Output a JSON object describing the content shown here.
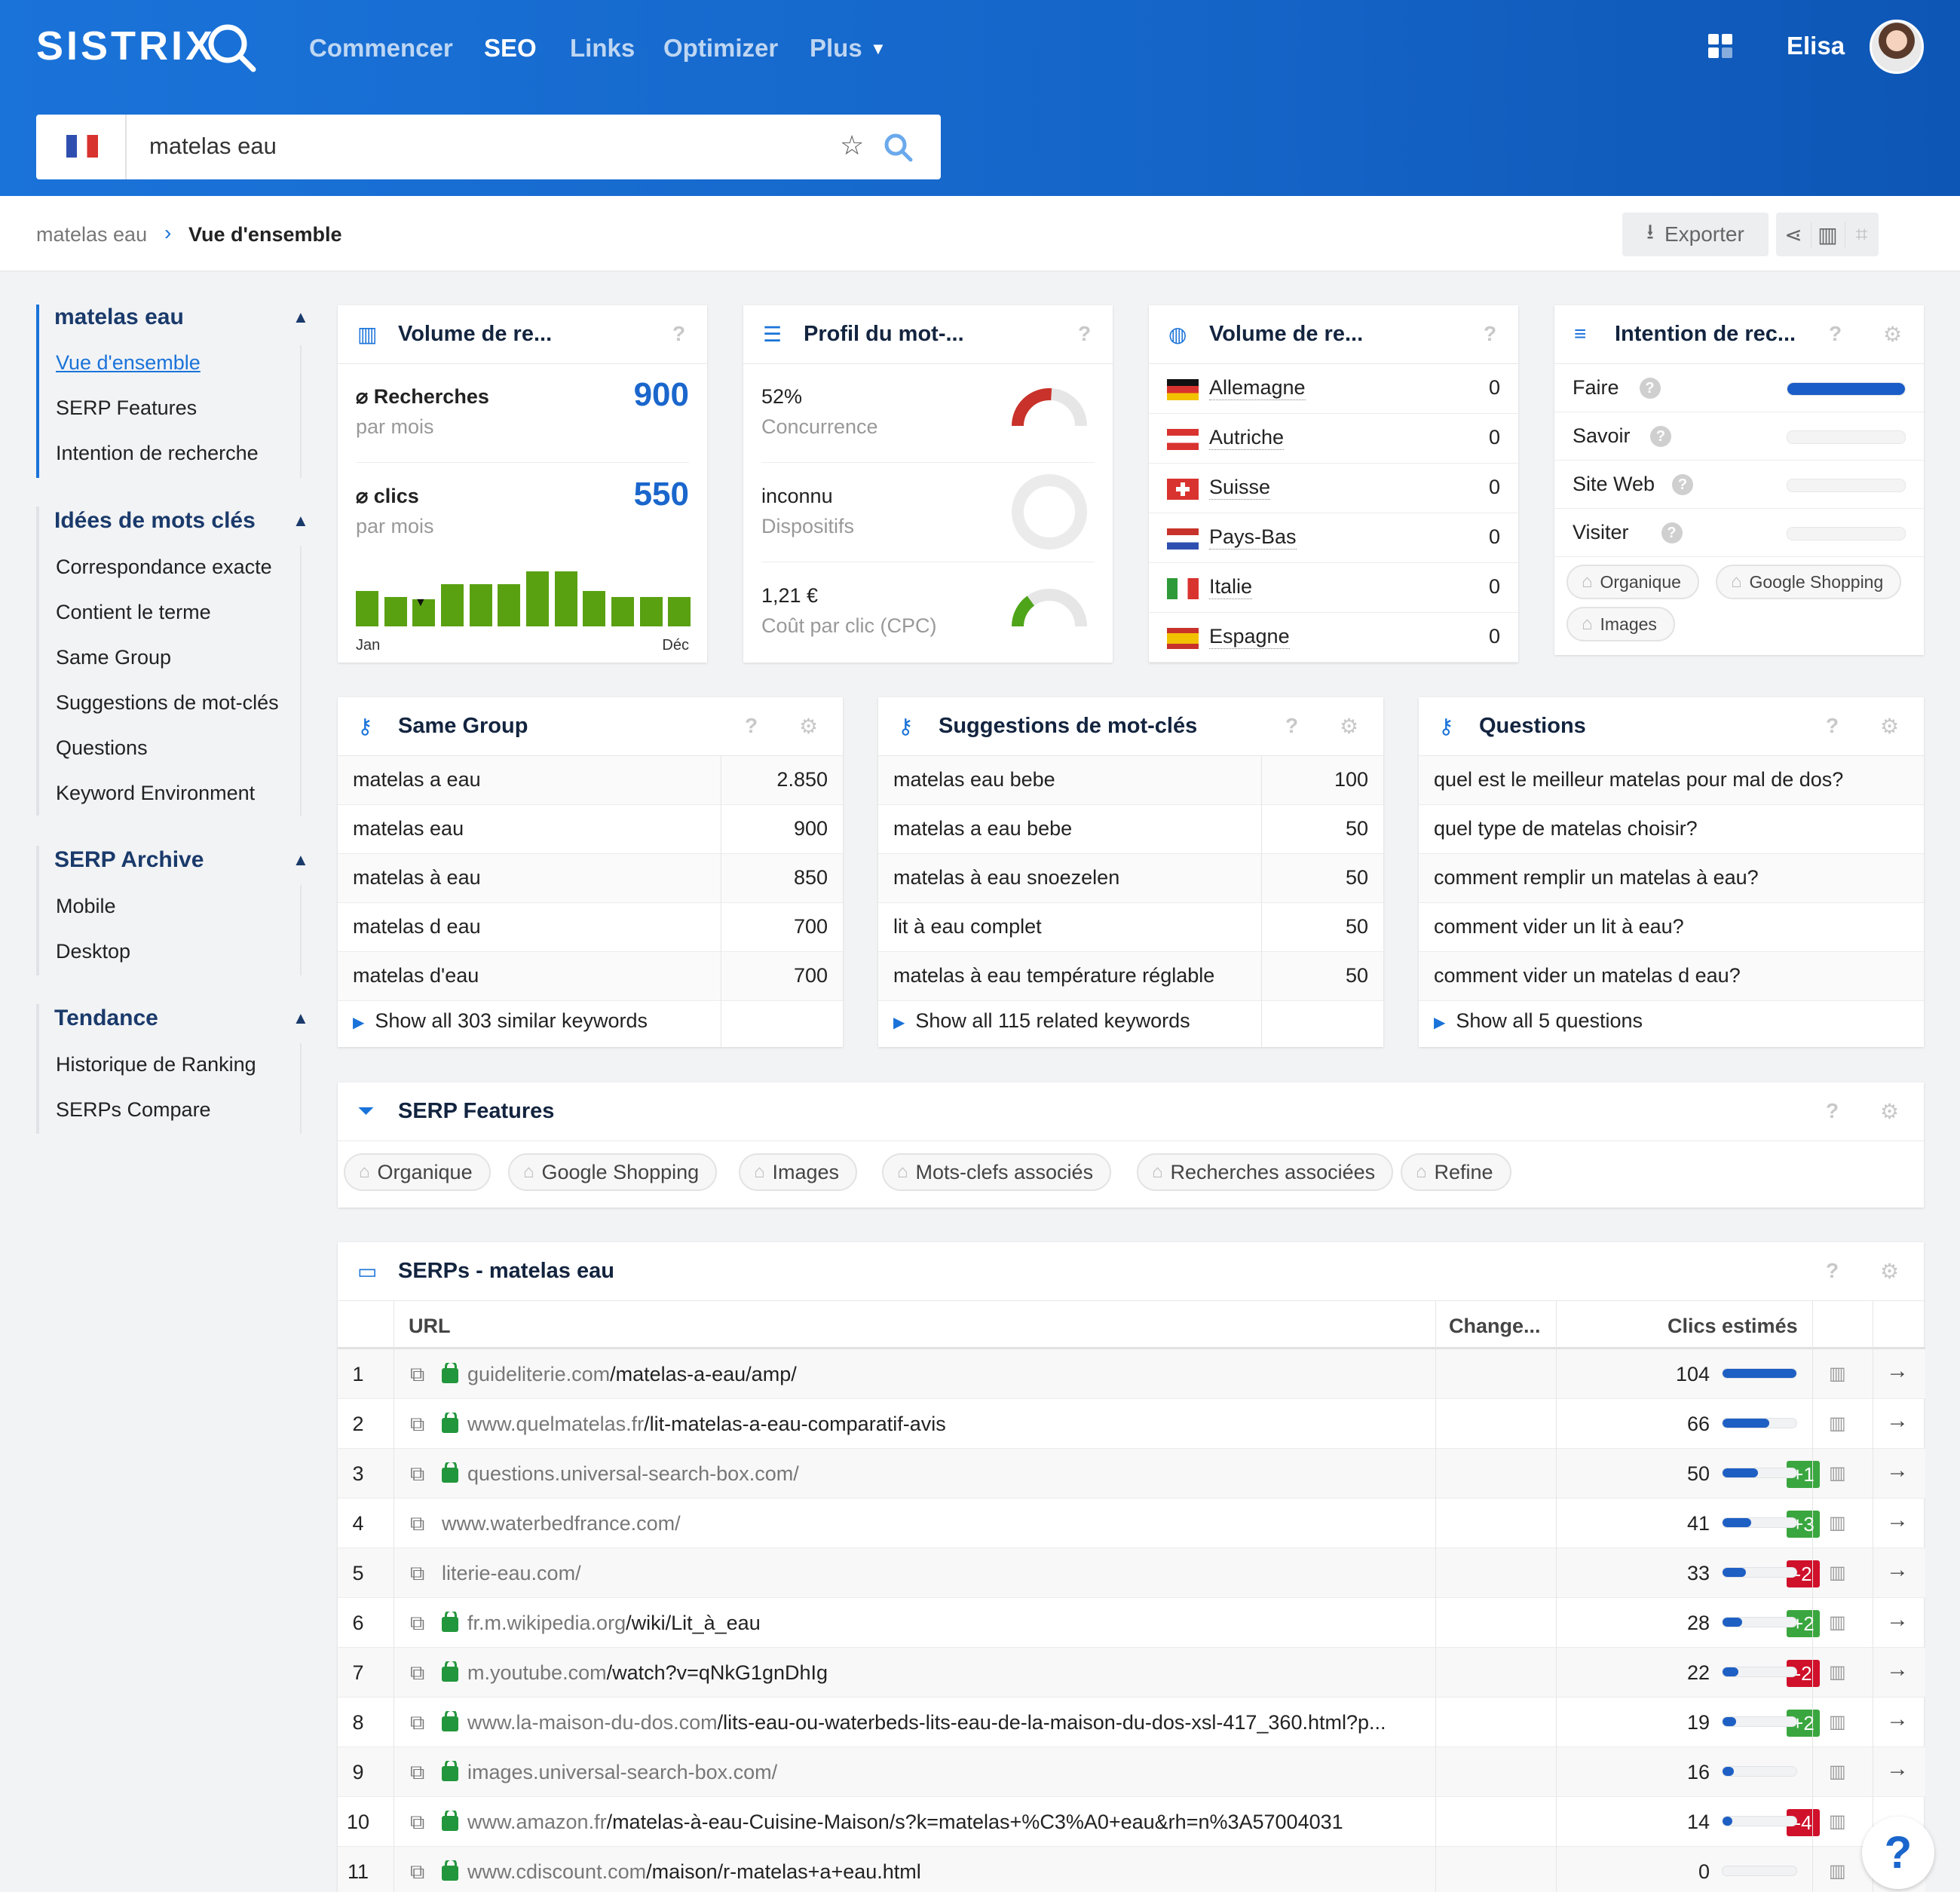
{
  "header": {
    "logo": "SISTRIX",
    "nav": [
      "Commencer",
      "SEO",
      "Links",
      "Optimizer",
      "Plus"
    ],
    "user": "Elisa"
  },
  "search": {
    "value": "matelas eau"
  },
  "breadcrumb": {
    "parent": "matelas eau",
    "current": "Vue d'ensemble"
  },
  "toolbar": {
    "export": "Exporter"
  },
  "sidebar": {
    "g1": {
      "title": "matelas eau",
      "items": [
        "Vue d'ensemble",
        "SERP Features",
        "Intention de recherche"
      ]
    },
    "g2": {
      "title": "Idées de mots clés",
      "items": [
        "Correspondance exacte",
        "Contient le terme",
        "Same Group",
        "Suggestions de mot-clés",
        "Questions",
        "Keyword Environment"
      ]
    },
    "g3": {
      "title": "SERP Archive",
      "items": [
        "Mobile",
        "Desktop"
      ]
    },
    "g4": {
      "title": "Tendance",
      "items": [
        "Historique de Ranking",
        "SERPs Compare"
      ]
    }
  },
  "vol": {
    "title": "Volume de re...",
    "searches_label": "⌀ Recherches",
    "searches": "900",
    "per_month": "par mois",
    "clicks_label": "⌀ clics",
    "clicks": "550",
    "per_month2": "par mois",
    "months": [
      0.55,
      0.45,
      0.42,
      0.65,
      0.65,
      0.65,
      0.85,
      0.85,
      0.55,
      0.45,
      0.45,
      0.45
    ],
    "start": "Jan",
    "end": "Déc"
  },
  "profil": {
    "title": "Profil du mot-...",
    "comp_value": "52%",
    "comp_label": "Concurrence",
    "comp_pct": 52,
    "dev_value": "inconnu",
    "dev_label": "Dispositifs",
    "cpc_value": "1,21 €",
    "cpc_label": "Coût par clic (CPC)",
    "cpc_pct": 30
  },
  "countries": {
    "title": "Volume de re...",
    "rows": [
      {
        "name": "Allemagne",
        "val": "0"
      },
      {
        "name": "Autriche",
        "val": "0"
      },
      {
        "name": "Suisse",
        "val": "0"
      },
      {
        "name": "Pays-Bas",
        "val": "0"
      },
      {
        "name": "Italie",
        "val": "0"
      },
      {
        "name": "Espagne",
        "val": "0"
      }
    ]
  },
  "intent": {
    "title": "Intention de rec...",
    "rows": [
      {
        "name": "Faire",
        "pct": 100
      },
      {
        "name": "Savoir",
        "pct": 0
      },
      {
        "name": "Site Web",
        "pct": 0
      },
      {
        "name": "Visiter",
        "pct": 0
      }
    ],
    "tags": [
      "Organique",
      "Google Shopping",
      "Images"
    ]
  },
  "same": {
    "title": "Same Group",
    "rows": [
      {
        "k": "matelas a eau",
        "v": "2.850"
      },
      {
        "k": "matelas eau",
        "v": "900"
      },
      {
        "k": "matelas à eau",
        "v": "850"
      },
      {
        "k": "matelas d eau",
        "v": "700"
      },
      {
        "k": "matelas d'eau",
        "v": "700"
      }
    ],
    "show": "Show all 303 similar keywords"
  },
  "sugg": {
    "title": "Suggestions de mot-clés",
    "rows": [
      {
        "k": "matelas eau bebe",
        "v": "100"
      },
      {
        "k": "matelas a eau bebe",
        "v": "50"
      },
      {
        "k": "matelas à eau snoezelen",
        "v": "50"
      },
      {
        "k": "lit à eau complet",
        "v": "50"
      },
      {
        "k": "matelas à eau température réglable",
        "v": "50"
      }
    ],
    "show": "Show all 115 related keywords"
  },
  "questions": {
    "title": "Questions",
    "rows": [
      "quel est le meilleur matelas pour mal de dos?",
      "quel type de matelas choisir?",
      "comment remplir un matelas à eau?",
      "comment vider un lit à eau?",
      "comment vider un matelas d eau?"
    ],
    "show": "Show all 5 questions"
  },
  "serpfeat": {
    "title": "SERP Features",
    "tags": [
      "Organique",
      "Google Shopping",
      "Images",
      "Mots-clefs associés",
      "Recherches associées",
      "Refine"
    ]
  },
  "serps": {
    "title": "SERPs - matelas eau",
    "col_url": "URL",
    "col_change": "Change...",
    "col_clicks": "Clics estimés",
    "rows": [
      {
        "pos": "1",
        "lock": true,
        "domain": "guideliterie.com",
        "path": "/matelas-a-eau/amp/",
        "change": "",
        "clicks": "104",
        "pct": 100
      },
      {
        "pos": "2",
        "lock": true,
        "domain": "www.quelmatelas.fr",
        "path": "/lit-matelas-a-eau-comparatif-avis",
        "change": "",
        "clicks": "66",
        "pct": 63
      },
      {
        "pos": "3",
        "lock": true,
        "domain": "questions.universal-search-box.com/",
        "path": "",
        "change": "+1",
        "clicks": "50",
        "pct": 48
      },
      {
        "pos": "4",
        "lock": false,
        "domain": "www.waterbedfrance.com/",
        "path": "",
        "change": "+3",
        "clicks": "41",
        "pct": 39
      },
      {
        "pos": "5",
        "lock": false,
        "domain": "literie-eau.com/",
        "path": "",
        "change": "-2",
        "clicks": "33",
        "pct": 32
      },
      {
        "pos": "6",
        "lock": true,
        "domain": "fr.m.wikipedia.org",
        "path": "/wiki/Lit_à_eau",
        "change": "+2",
        "clicks": "28",
        "pct": 27
      },
      {
        "pos": "7",
        "lock": true,
        "domain": "m.youtube.com",
        "path": "/watch?v=qNkG1gnDhIg",
        "change": "-2",
        "clicks": "22",
        "pct": 21
      },
      {
        "pos": "8",
        "lock": true,
        "domain": "www.la-maison-du-dos.com",
        "path": "/lits-eau-ou-waterbeds-lits-eau-de-la-maison-du-dos-xsl-417_360.html?p...",
        "change": "+2",
        "clicks": "19",
        "pct": 18
      },
      {
        "pos": "9",
        "lock": true,
        "domain": "images.universal-search-box.com/",
        "path": "",
        "change": "",
        "clicks": "16",
        "pct": 15
      },
      {
        "pos": "10",
        "lock": true,
        "domain": "www.amazon.fr",
        "path": "/matelas-à-eau-Cuisine-Maison/s?k=matelas+%C3%A0+eau&rh=n%3A57004031",
        "change": "-4",
        "clicks": "14",
        "pct": 13
      },
      {
        "pos": "11",
        "lock": true,
        "domain": "www.cdiscount.com",
        "path": "/maison/r-matelas+a+eau.html",
        "change": "",
        "clicks": "0",
        "pct": 0
      }
    ]
  },
  "colors": {
    "accent": "#1a73d9",
    "positive": "#3aa63f",
    "negative": "#d0112b"
  }
}
